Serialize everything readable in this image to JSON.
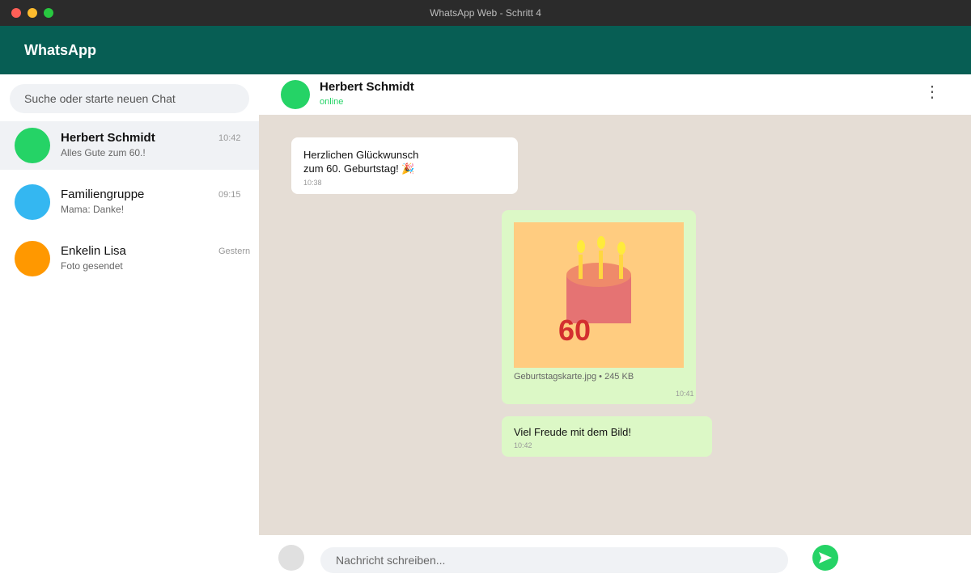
{
  "window": {
    "title": "WhatsApp Web - Schritt 4"
  },
  "app": {
    "title": "WhatsApp"
  },
  "colors": {
    "header": "#075e54",
    "accent_green": "#25d366",
    "outgoing_bubble": "#dcf8c6",
    "chat_background": "#e5ddd5"
  },
  "search": {
    "placeholder": "Suche oder starte neuen Chat"
  },
  "chats": [
    {
      "name": "Herbert Schmidt",
      "preview": "Alles Gute zum 60.!",
      "time": "10:42",
      "avatar_color": "#25d366",
      "active": true
    },
    {
      "name": "Familiengruppe",
      "preview": "Mama: Danke!",
      "time": "09:15",
      "avatar_color": "#34b7f1",
      "active": false
    },
    {
      "name": "Enkelin Lisa",
      "preview": "Foto gesendet",
      "time": "Gestern",
      "avatar_color": "#ff9800",
      "active": false
    }
  ],
  "chat_header": {
    "name": "Herbert Schmidt",
    "status": "online",
    "avatar_color": "#25d366",
    "menu_icon": "more-vertical-icon"
  },
  "messages": [
    {
      "direction": "incoming",
      "line1": "Herzlichen Glückwunsch",
      "line2": "zum 60. Geburtstag! 🎉",
      "time": "10:38"
    },
    {
      "direction": "outgoing",
      "type": "image",
      "image_text": "60",
      "file_info": "Geburtstagskarte.jpg • 245 KB",
      "time": "10:41"
    },
    {
      "direction": "outgoing",
      "text": "Viel Freude mit dem Bild!",
      "time": "10:42"
    }
  ],
  "composer": {
    "placeholder": "Nachricht schreiben...",
    "attach_icon": "attach-icon",
    "send_icon": "send-icon"
  }
}
